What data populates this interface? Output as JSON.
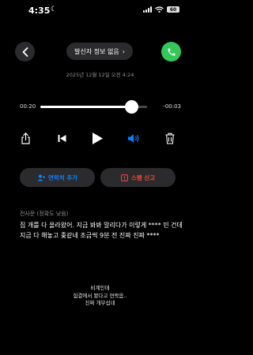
{
  "status_bar": {
    "time": "4:35",
    "battery": "60"
  },
  "header": {
    "caller_label": "발신자 정보 없음",
    "caller_chevron": "›"
  },
  "recording": {
    "date": "2025년 12월 12일 오전 4:24"
  },
  "player": {
    "elapsed": "00:20",
    "remaining": "-00:03",
    "progress": 0.85
  },
  "controls": [
    "share-icon",
    "skip-back-icon",
    "play-icon",
    "speaker-icon",
    "trash-icon"
  ],
  "actions": {
    "add_contact": "연락처 추가",
    "report_spam": "스팸 신고"
  },
  "colors": {
    "accent_blue": "#0a84ff",
    "spam_red": "#ff453a",
    "call_green": "#34c759"
  },
  "transcript": {
    "label": "전사문 (정확도 낮음)",
    "text": "집 개를 다 올라왔어. 지금 봐봐 말리다가 이렇게 **** 민 건데 지금 다 해놓고 좆같네 조금씩 9분 전 진짜  진짜 ****"
  },
  "note": {
    "line1": "비계인데",
    "line2": "힘결에서 봤다고 연락옴..",
    "line3": "진짜 개무섭네"
  }
}
